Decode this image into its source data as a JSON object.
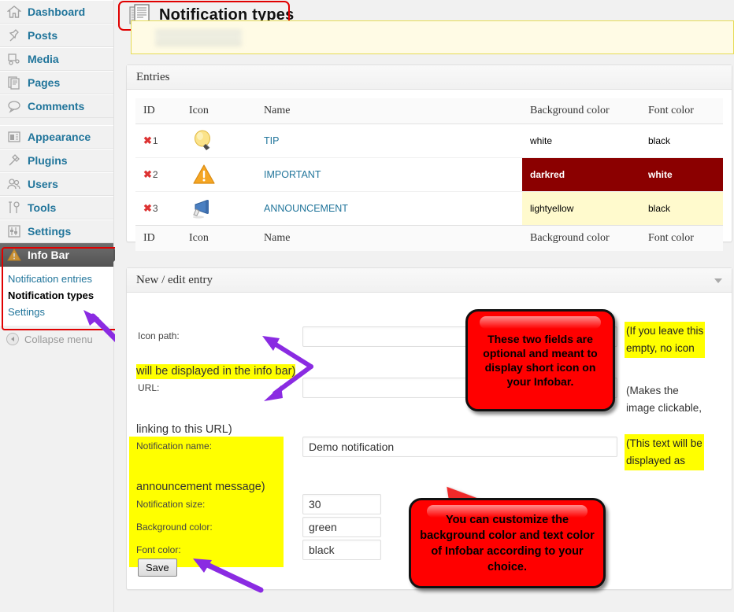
{
  "sidebar": {
    "items": [
      {
        "label": "Dashboard",
        "icon": "home-icon"
      },
      {
        "label": "Posts",
        "icon": "pin-icon"
      },
      {
        "label": "Media",
        "icon": "media-icon"
      },
      {
        "label": "Pages",
        "icon": "pages-icon"
      },
      {
        "label": "Comments",
        "icon": "comment-bubble-icon"
      },
      {
        "label": "Appearance",
        "icon": "appearance-icon"
      },
      {
        "label": "Plugins",
        "icon": "plug-icon"
      },
      {
        "label": "Users",
        "icon": "users-icon"
      },
      {
        "label": "Tools",
        "icon": "tools-icon"
      },
      {
        "label": "Settings",
        "icon": "settings-sliders-icon"
      }
    ],
    "active_parent": {
      "label": "Info Bar",
      "icon": "warning-triangle-icon"
    },
    "submenu": [
      {
        "label": "Notification entries",
        "current": false
      },
      {
        "label": "Notification types",
        "current": true
      },
      {
        "label": "Settings",
        "current": false
      }
    ],
    "collapse": {
      "label": "Collapse menu",
      "icon": "collapse-left-icon"
    }
  },
  "header": {
    "title": "Notification types",
    "icon": "documents-icon"
  },
  "entries_panel": {
    "title": "Entries",
    "columns": [
      "ID",
      "Icon",
      "Name",
      "Background color",
      "Font color"
    ],
    "rows": [
      {
        "id": "1",
        "delete_icon": "delete-x-icon",
        "icon": "lightbulb-icon",
        "name": "TIP",
        "background_color": "white",
        "font_color": "black",
        "row_bg_hex": "#ffffff",
        "row_fg_hex": "#000000"
      },
      {
        "id": "2",
        "delete_icon": "delete-x-icon",
        "icon": "warning-triangle-icon",
        "name": "IMPORTANT",
        "background_color": "darkred",
        "font_color": "white",
        "row_bg_hex": "#8b0000",
        "row_fg_hex": "#ffffff"
      },
      {
        "id": "3",
        "delete_icon": "delete-x-icon",
        "icon": "megaphone-icon",
        "name": "ANNOUNCEMENT",
        "background_color": "lightyellow",
        "font_color": "black",
        "row_bg_hex": "#fffacd",
        "row_fg_hex": "#000000"
      }
    ]
  },
  "form_panel": {
    "title": "New / edit entry",
    "toggle_icon": "chevron-down-icon",
    "fields": {
      "icon_path_label": "Icon path:",
      "icon_path_value": "",
      "url_label": "URL:",
      "url_value": "",
      "notification_name_label": "Notification name:",
      "notification_name_value": "Demo notification",
      "notification_size_label": "Notification size:",
      "notification_size_value": "30",
      "background_color_label": "Background color:",
      "background_color_value": "green",
      "font_color_label": "Font color:",
      "font_color_value": "black"
    },
    "save_label": "Save"
  },
  "annotations": {
    "highlight_info_bar": "will be displayed in the info bar)",
    "plain_linking_url": "linking to this URL)",
    "highlight_announcement": "announcement message)",
    "right_note_1_line1": "(If you leave this",
    "right_note_1_line2": "empty, no icon",
    "right_note_2_line1": "(Makes the",
    "right_note_2_line2": "image clickable,",
    "right_note_3_line1": "(This text will be",
    "right_note_3_line2": "displayed as",
    "callout_1": "These two fields are optional and meant to display short icon on your Infobar.",
    "callout_2": "You can customize the background color and text color of Infobar according to your choice.",
    "arrow_color": "#8a2be2",
    "callout_color": "#ff0000",
    "highlight_color": "#ffff00",
    "outline_color": "#e00000"
  }
}
